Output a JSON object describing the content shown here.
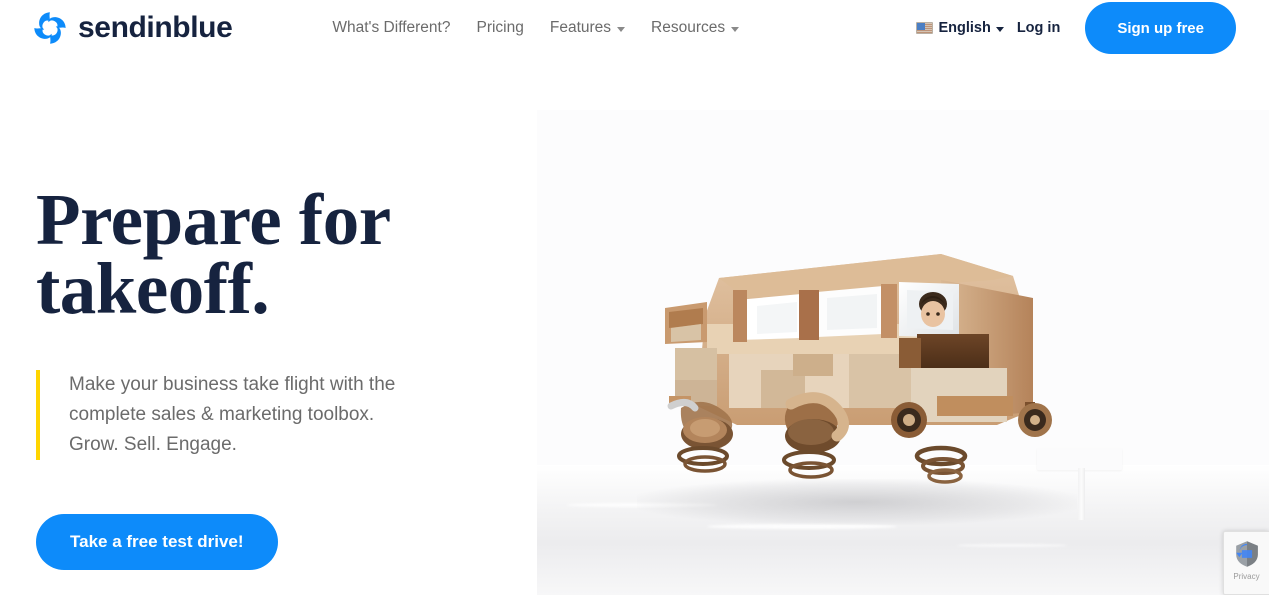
{
  "header": {
    "brand": {
      "name": "sendinblue",
      "logo_icon": "pinwheel-logo-icon",
      "color": "#0d8bfa"
    },
    "nav": [
      {
        "label": "What's Different?",
        "has_dropdown": false
      },
      {
        "label": "Pricing",
        "has_dropdown": false
      },
      {
        "label": "Features",
        "has_dropdown": true
      },
      {
        "label": "Resources",
        "has_dropdown": true
      }
    ],
    "language": {
      "label": "English",
      "flag_icon": "us-flag-icon",
      "caret_icon": "chevron-down-icon"
    },
    "login_label": "Log in",
    "signup_label": "Sign up free"
  },
  "hero": {
    "title": "Prepare for\ntakeoff.",
    "subtitle": "Make your business take flight with the\ncomplete sales & marketing toolbox.\nGrow. Sell. Engage.",
    "accent_color": "#FFD500",
    "cta_label": "Take a free test drive!",
    "image": {
      "alt": "wooden-toy-van-illustration",
      "description": "Wooden block camper van with a person driving, mounted on springs"
    }
  },
  "recaptcha": {
    "label": "Privacy",
    "icon": "recaptcha-shield-icon"
  },
  "colors": {
    "primary_blue": "#0d8bfa",
    "navy": "#16233F",
    "gray_text": "#6B6B6B",
    "yellow_accent": "#FFD500",
    "panel_bg": "#FCFCFD"
  }
}
